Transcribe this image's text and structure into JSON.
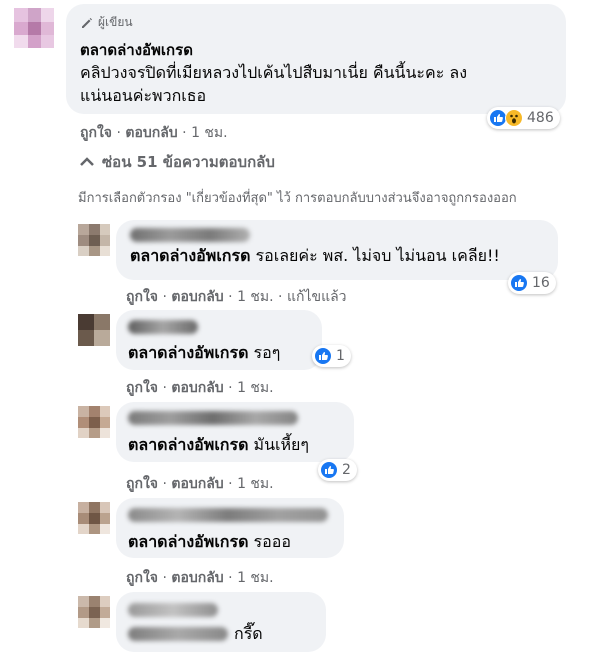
{
  "main_comment": {
    "author_badge": "ผู้เขียน",
    "author": "ตลาดล่างอัพเกรด",
    "text_line1": "คลิปวงจรปิดที่เมียหลวงไปเค้นไปสืบมาเนี่ย คืนนี้นะคะ ลง",
    "text_line2": "แน่นอนค่ะพวกเธอ",
    "reaction_count": "486",
    "like": "ถูกใจ",
    "reply": "ตอบกลับ",
    "time": "1 ชม."
  },
  "hide_replies": "ซ่อน 51 ข้อความตอบกลับ",
  "filter_note": "มีการเลือกตัวกรอง \"เกี่ยวข้องที่สุด\" ไว้ การตอบกลับบางส่วนจึงอาจถูกกรองออก",
  "replies": [
    {
      "mention": "ตลาดล่างอัพเกรด",
      "text": " รอเลยค่ะ พส. ไม่จบ ไม่นอน เคลีย!!",
      "reactions": "16",
      "like": "ถูกใจ",
      "reply": "ตอบกลับ",
      "time": "1 ชม.",
      "edited": "แก้ไขแล้ว"
    },
    {
      "mention": "ตลาดล่างอัพเกรด",
      "text": " รอๆ",
      "reactions": "1",
      "like": "ถูกใจ",
      "reply": "ตอบกลับ",
      "time": "1 ชม."
    },
    {
      "mention": "ตลาดล่างอัพเกรด",
      "text": " มันเหี้ยๆ",
      "reactions": "2",
      "like": "ถูกใจ",
      "reply": "ตอบกลับ",
      "time": "1 ชม."
    },
    {
      "mention": "ตลาดล่างอัพเกรด",
      "text": " รอออ",
      "like": "ถูกใจ",
      "reply": "ตอบกลับ",
      "time": "1 ชม."
    },
    {
      "text": "กรี๊ด"
    }
  ],
  "colors": {
    "bubble": "#f0f2f5",
    "meta": "#65676b",
    "like_blue": "#1877f2",
    "wow_yellow": "#f7b928"
  }
}
